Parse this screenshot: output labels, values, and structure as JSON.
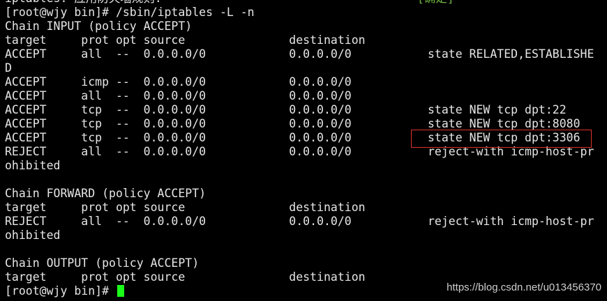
{
  "terminal": {
    "cut_top_left": "iptables: 应用防火墙规则:",
    "cut_top_right": "[确定]",
    "lines": [
      "[root@wjy bin]# /sbin/iptables -L -n",
      "Chain INPUT (policy ACCEPT)",
      "target     prot opt source               destination",
      "ACCEPT     all  --  0.0.0.0/0            0.0.0.0/0           state RELATED,ESTABLISHE",
      "D",
      "ACCEPT     icmp --  0.0.0.0/0            0.0.0.0/0",
      "ACCEPT     all  --  0.0.0.0/0            0.0.0.0/0",
      "ACCEPT     tcp  --  0.0.0.0/0            0.0.0.0/0           state NEW tcp dpt:22",
      "ACCEPT     tcp  --  0.0.0.0/0            0.0.0.0/0           state NEW tcp dpt:8080",
      "ACCEPT     tcp  --  0.0.0.0/0            0.0.0.0/0           state NEW tcp dpt:3306",
      "REJECT     all  --  0.0.0.0/0            0.0.0.0/0           reject-with icmp-host-pr",
      "ohibited",
      "",
      "Chain FORWARD (policy ACCEPT)",
      "target     prot opt source               destination",
      "REJECT     all  --  0.0.0.0/0            0.0.0.0/0           reject-with icmp-host-pr",
      "ohibited",
      "",
      "Chain OUTPUT (policy ACCEPT)",
      "target     prot opt source               destination",
      "[root@wjy bin]# "
    ],
    "highlight_color": "#e0322c",
    "cursor_color": "#1aff1a"
  },
  "watermark": "https://blog.csdn.net/u013456370"
}
